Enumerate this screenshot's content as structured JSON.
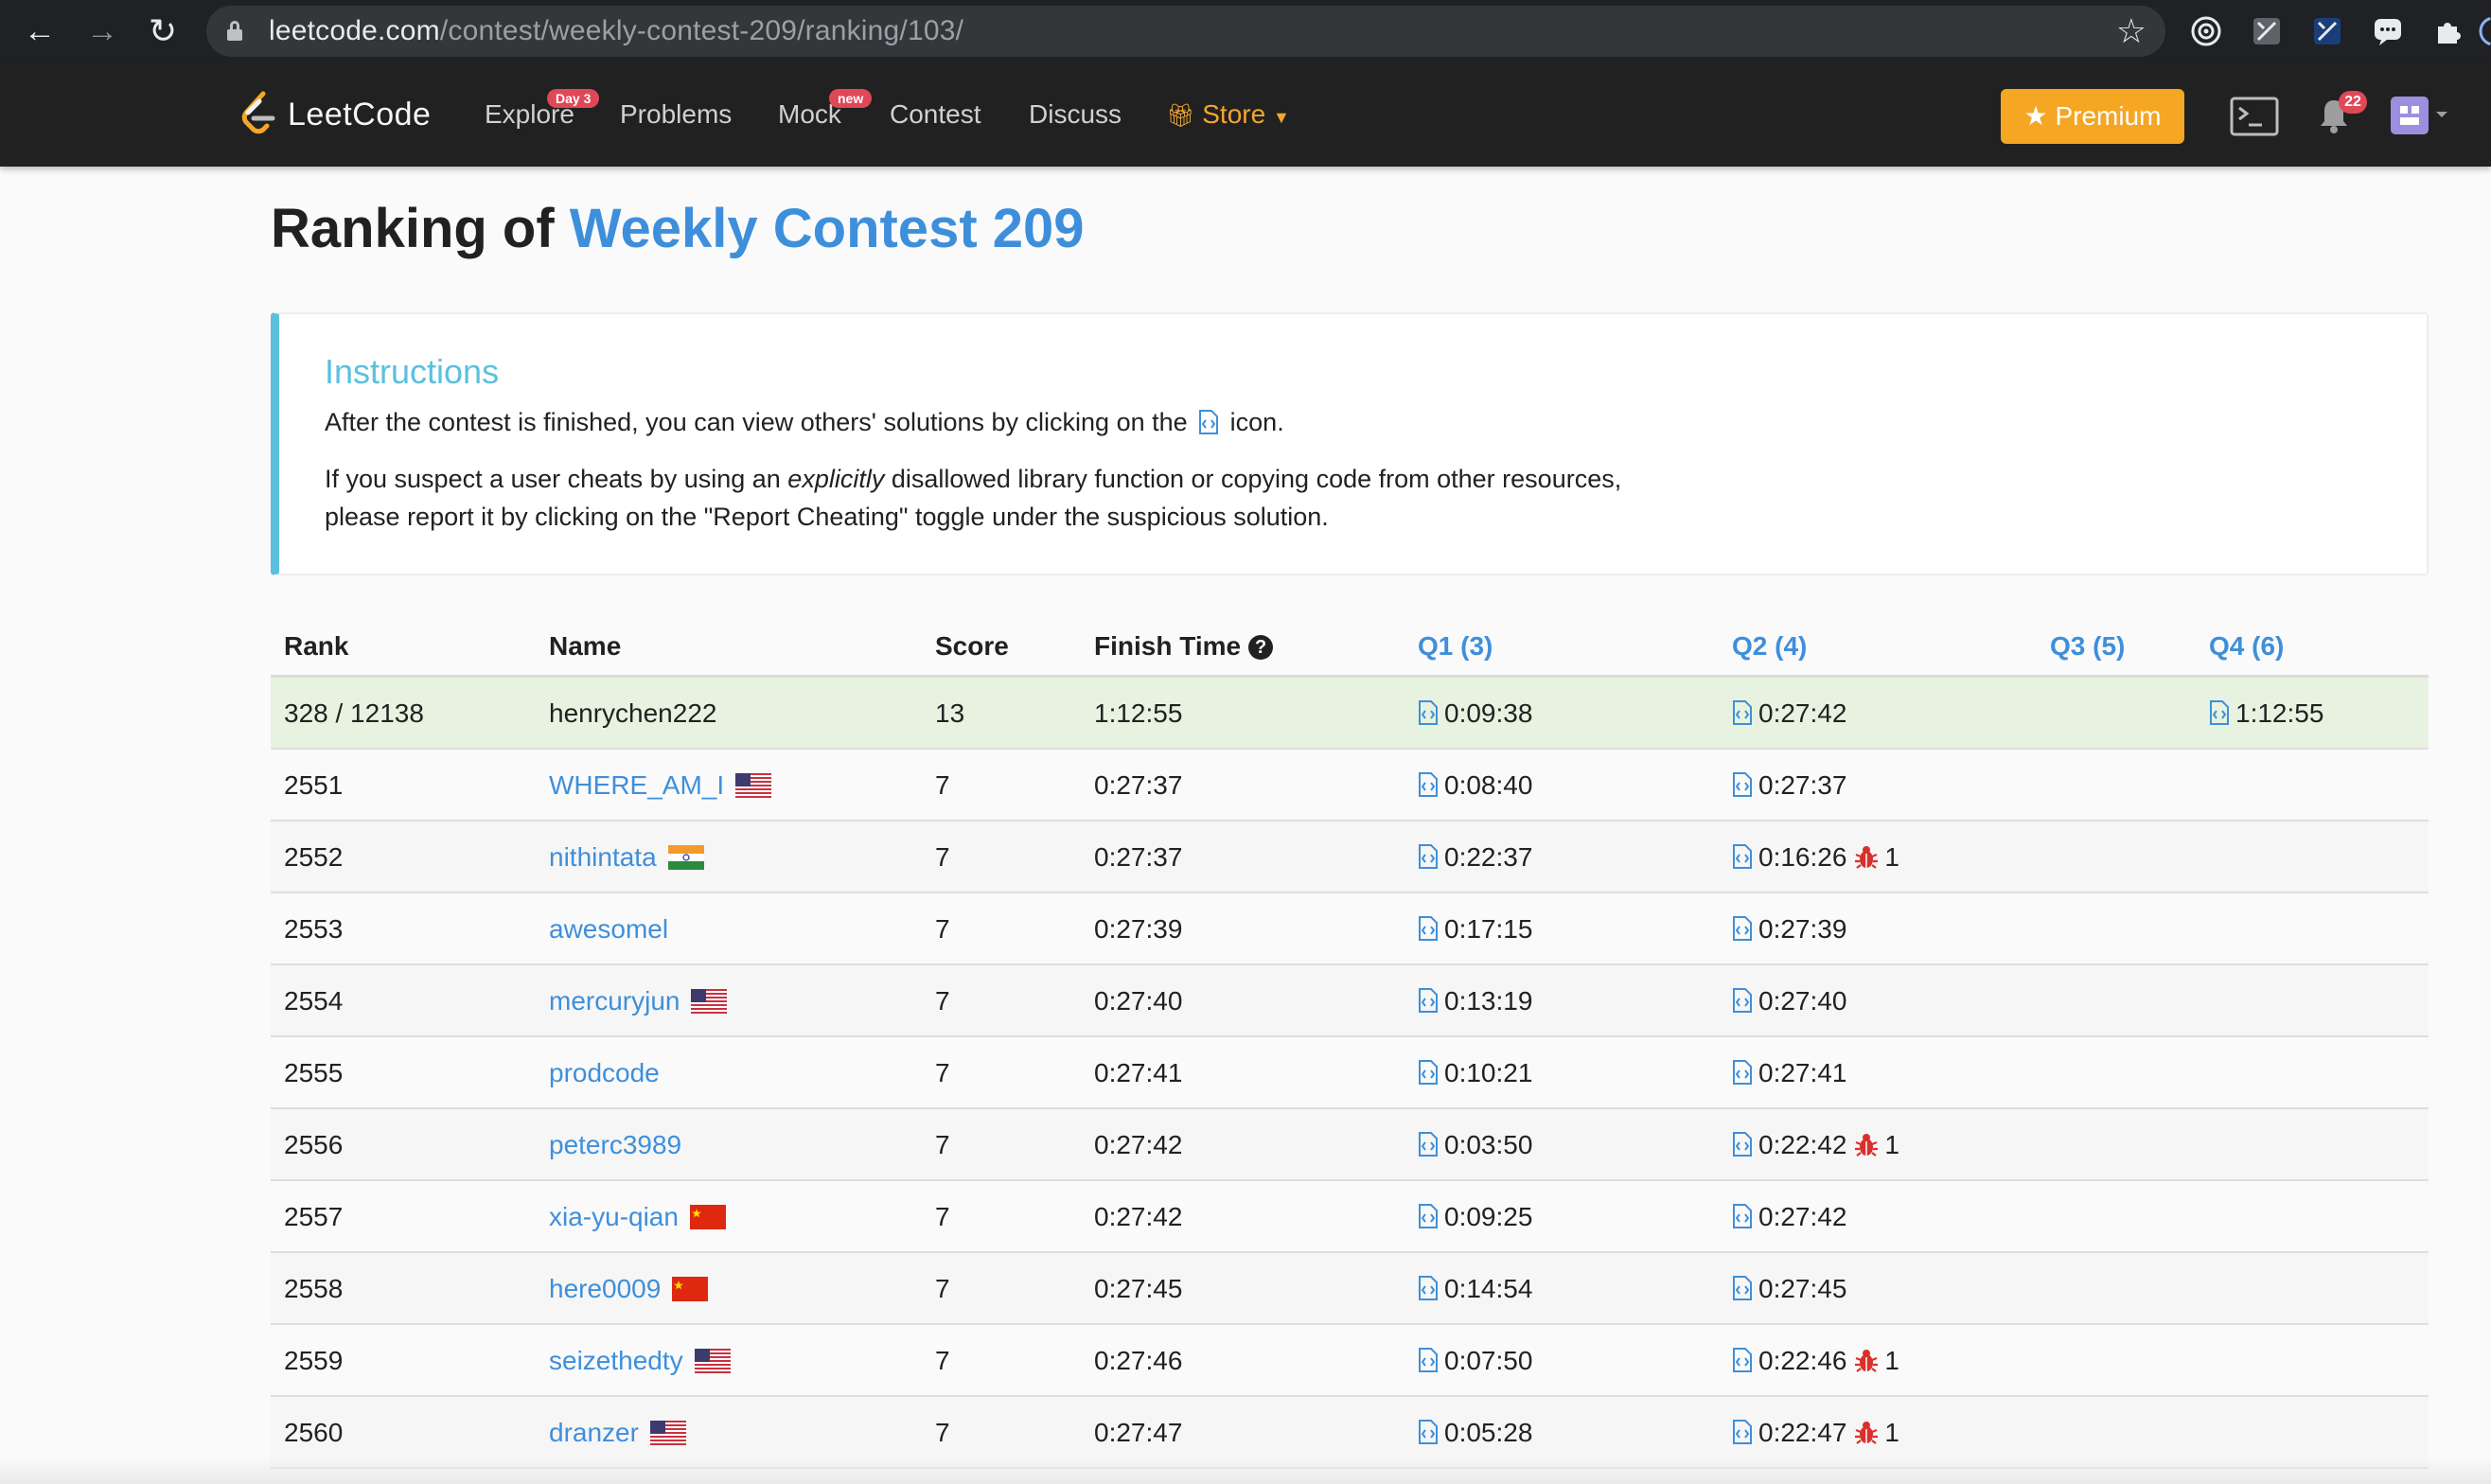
{
  "browser": {
    "url_host": "leetcode.com",
    "url_path": "/contest/weekly-contest-209/ranking/103/"
  },
  "nav": {
    "logo": "LeetCode",
    "explore": "Explore",
    "explore_badge": "Day 3",
    "problems": "Problems",
    "mock": "Mock",
    "mock_badge": "new",
    "contest": "Contest",
    "discuss": "Discuss",
    "store": "Store",
    "premium": "Premium",
    "notifications": "22"
  },
  "page": {
    "title_prefix": "Ranking of",
    "title_link": "Weekly Contest 209"
  },
  "instructions": {
    "heading": "Instructions",
    "line1_before": "After the contest is finished, you can view others' solutions by clicking on the",
    "line1_after": "icon.",
    "line2_before": "If you suspect a user cheats by using an",
    "line2_em": "explicitly",
    "line2_after": "disallowed library function or copying code from other resources,",
    "line3": "please report it by clicking on the \"Report Cheating\" toggle under the suspicious solution."
  },
  "table": {
    "headers": {
      "rank": "Rank",
      "name": "Name",
      "score": "Score",
      "finish": "Finish Time",
      "q1": "Q1 (3)",
      "q2": "Q2 (4)",
      "q3": "Q3 (5)",
      "q4": "Q4 (6)"
    },
    "rows": [
      {
        "rank": "328 / 12138",
        "name": "henrychen222",
        "score": "13",
        "finish": "1:12:55",
        "q1": "0:09:38",
        "q2": "0:27:42",
        "q2_bugs": "",
        "q4": "1:12:55",
        "flag": ""
      },
      {
        "rank": "2551",
        "name": "WHERE_AM_I",
        "score": "7",
        "finish": "0:27:37",
        "q1": "0:08:40",
        "q2": "0:27:37",
        "q2_bugs": "",
        "q4": "",
        "flag": "us"
      },
      {
        "rank": "2552",
        "name": "nithintata",
        "score": "7",
        "finish": "0:27:37",
        "q1": "0:22:37",
        "q2": "0:16:26",
        "q2_bugs": "1",
        "q4": "",
        "flag": "in"
      },
      {
        "rank": "2553",
        "name": "awesomel",
        "score": "7",
        "finish": "0:27:39",
        "q1": "0:17:15",
        "q2": "0:27:39",
        "q2_bugs": "",
        "q4": "",
        "flag": ""
      },
      {
        "rank": "2554",
        "name": "mercuryjun",
        "score": "7",
        "finish": "0:27:40",
        "q1": "0:13:19",
        "q2": "0:27:40",
        "q2_bugs": "",
        "q4": "",
        "flag": "us"
      },
      {
        "rank": "2555",
        "name": "prodcode",
        "score": "7",
        "finish": "0:27:41",
        "q1": "0:10:21",
        "q2": "0:27:41",
        "q2_bugs": "",
        "q4": "",
        "flag": ""
      },
      {
        "rank": "2556",
        "name": "peterc3989",
        "score": "7",
        "finish": "0:27:42",
        "q1": "0:03:50",
        "q2": "0:22:42",
        "q2_bugs": "1",
        "q4": "",
        "flag": ""
      },
      {
        "rank": "2557",
        "name": "xia-yu-qian",
        "score": "7",
        "finish": "0:27:42",
        "q1": "0:09:25",
        "q2": "0:27:42",
        "q2_bugs": "",
        "q4": "",
        "flag": "cn"
      },
      {
        "rank": "2558",
        "name": "here0009",
        "score": "7",
        "finish": "0:27:45",
        "q1": "0:14:54",
        "q2": "0:27:45",
        "q2_bugs": "",
        "q4": "",
        "flag": "cn"
      },
      {
        "rank": "2559",
        "name": "seizethedty",
        "score": "7",
        "finish": "0:27:46",
        "q1": "0:07:50",
        "q2": "0:22:46",
        "q2_bugs": "1",
        "q4": "",
        "flag": "us"
      },
      {
        "rank": "2560",
        "name": "dranzer",
        "score": "7",
        "finish": "0:27:47",
        "q1": "0:05:28",
        "q2": "0:22:47",
        "q2_bugs": "1",
        "q4": "",
        "flag": "us"
      }
    ]
  },
  "colors": {
    "accent": "#3e8fdb",
    "info": "#5bc0de",
    "premium": "#f5a623",
    "self_row": "#e7f3e0",
    "bug": "#d9302c"
  }
}
